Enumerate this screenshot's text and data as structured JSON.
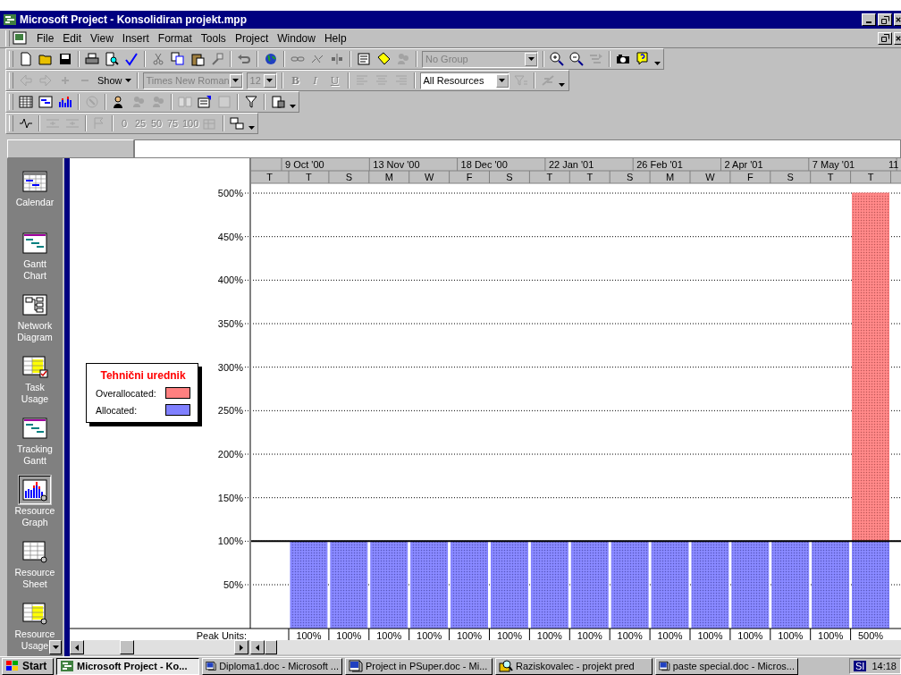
{
  "window": {
    "title": "Microsoft Project - Konsolidiran projekt.mpp"
  },
  "menu": [
    "File",
    "Edit",
    "View",
    "Insert",
    "Format",
    "Tools",
    "Project",
    "Window",
    "Help"
  ],
  "toolbars": [
    {
      "items": [
        {
          "kind": "button",
          "disabled": false
        },
        {
          "kind": "button",
          "disabled": false
        },
        {
          "kind": "button",
          "disabled": false
        },
        {
          "kind": "separator"
        },
        {
          "kind": "button",
          "disabled": false
        },
        {
          "kind": "button",
          "disabled": false
        },
        {
          "kind": "button",
          "disabled": false
        },
        {
          "kind": "separator"
        },
        {
          "kind": "button",
          "disabled": true
        },
        {
          "kind": "button",
          "disabled": false
        },
        {
          "kind": "button",
          "disabled": false
        },
        {
          "kind": "button",
          "disabled": true
        },
        {
          "kind": "separator"
        },
        {
          "kind": "button",
          "disabled": true
        },
        {
          "kind": "separator"
        },
        {
          "kind": "button",
          "disabled": false
        },
        {
          "kind": "separator"
        },
        {
          "kind": "button",
          "disabled": true
        },
        {
          "kind": "button",
          "disabled": true
        },
        {
          "kind": "button",
          "disabled": true
        },
        {
          "kind": "separator"
        },
        {
          "kind": "button",
          "disabled": false
        },
        {
          "kind": "button",
          "disabled": false
        },
        {
          "kind": "button",
          "disabled": true
        },
        {
          "kind": "separator"
        },
        {
          "kind": "combo",
          "value": "No Group",
          "disabled": true
        },
        {
          "kind": "separator"
        },
        {
          "kind": "button",
          "disabled": false
        },
        {
          "kind": "button",
          "disabled": false
        },
        {
          "kind": "button",
          "disabled": true
        },
        {
          "kind": "separator"
        },
        {
          "kind": "button",
          "disabled": false
        },
        {
          "kind": "button",
          "disabled": false
        },
        {
          "kind": "button",
          "disabled": false
        }
      ]
    },
    {
      "items": [
        {
          "kind": "button",
          "disabled": true
        },
        {
          "kind": "button",
          "disabled": true
        },
        {
          "kind": "button",
          "disabled": true
        },
        {
          "kind": "button",
          "disabled": true
        },
        {
          "kind": "menu",
          "label": "Show",
          "disabled": false
        },
        {
          "kind": "separator"
        },
        {
          "kind": "combo",
          "value": "Times New Roman",
          "disabled": true
        },
        {
          "kind": "combo",
          "value": "12",
          "disabled": true
        },
        {
          "kind": "separator"
        },
        {
          "kind": "text",
          "label": "B",
          "disabled": true
        },
        {
          "kind": "text",
          "label": "I",
          "disabled": true
        },
        {
          "kind": "text",
          "label": "U",
          "disabled": true
        },
        {
          "kind": "separator"
        },
        {
          "kind": "button",
          "disabled": true
        },
        {
          "kind": "button",
          "disabled": true
        },
        {
          "kind": "button",
          "disabled": true
        },
        {
          "kind": "separator"
        },
        {
          "kind": "combo",
          "value": "All Resources",
          "disabled": false
        },
        {
          "kind": "button",
          "disabled": true
        },
        {
          "kind": "separator"
        },
        {
          "kind": "button",
          "disabled": true
        },
        {
          "kind": "button",
          "disabled": false
        }
      ]
    },
    {
      "items": [
        {
          "kind": "button",
          "disabled": false
        },
        {
          "kind": "button",
          "disabled": false
        },
        {
          "kind": "button",
          "disabled": false
        },
        {
          "kind": "separator"
        },
        {
          "kind": "button",
          "disabled": true
        },
        {
          "kind": "separator"
        },
        {
          "kind": "button",
          "disabled": false
        },
        {
          "kind": "button",
          "disabled": true
        },
        {
          "kind": "button",
          "disabled": true
        },
        {
          "kind": "separator"
        },
        {
          "kind": "button",
          "disabled": true
        },
        {
          "kind": "button",
          "disabled": false
        },
        {
          "kind": "button",
          "disabled": true
        },
        {
          "kind": "separator"
        },
        {
          "kind": "button",
          "disabled": false
        },
        {
          "kind": "separator"
        },
        {
          "kind": "button",
          "disabled": false
        },
        {
          "kind": "button",
          "disabled": false
        }
      ]
    },
    {
      "items": [
        {
          "kind": "button",
          "disabled": false
        },
        {
          "kind": "separator"
        },
        {
          "kind": "button",
          "disabled": true
        },
        {
          "kind": "button",
          "disabled": true
        },
        {
          "kind": "separator"
        },
        {
          "kind": "button",
          "disabled": true
        },
        {
          "kind": "separator"
        },
        {
          "kind": "percent",
          "label": "0",
          "disabled": true
        },
        {
          "kind": "percent",
          "label": "25",
          "disabled": true
        },
        {
          "kind": "percent",
          "label": "50",
          "disabled": true
        },
        {
          "kind": "percent",
          "label": "75",
          "disabled": true
        },
        {
          "kind": "percent",
          "label": "100",
          "disabled": true
        },
        {
          "kind": "button",
          "disabled": true
        },
        {
          "kind": "separator"
        },
        {
          "kind": "button",
          "disabled": false
        },
        {
          "kind": "button",
          "disabled": false
        }
      ]
    }
  ],
  "view_bar": {
    "items": [
      {
        "label": "Calendar",
        "selected": false
      },
      {
        "label": "Gantt Chart",
        "selected": false
      },
      {
        "label": "Network Diagram",
        "selected": false
      },
      {
        "label": "Task Usage",
        "selected": false
      },
      {
        "label": "Tracking Gantt",
        "selected": false
      },
      {
        "label": "Resource Graph",
        "selected": true
      },
      {
        "label": "Resource Sheet",
        "selected": false
      },
      {
        "label": "Resource Usage",
        "selected": false
      }
    ]
  },
  "graph": {
    "legend": {
      "title": "Tehnični urednik",
      "items": [
        {
          "label": "Overallocated:",
          "color": "#ff8080"
        },
        {
          "label": "Allocated:",
          "color": "#8080ff"
        }
      ]
    },
    "timescale_major": [
      "9 Oct '00",
      "13 Nov '00",
      "18 Dec '00",
      "22 Jan '01",
      "26 Feb '01",
      "2 Apr '01",
      "7 May '01",
      "11"
    ],
    "peak_units_label": "Peak Units:",
    "peak_units": [
      "100%",
      "100%",
      "100%",
      "100%",
      "100%",
      "100%",
      "100%",
      "100%",
      "100%",
      "100%",
      "100%",
      "100%",
      "100%",
      "100%",
      "500%"
    ],
    "chart_data": {
      "type": "bar",
      "stacked": true,
      "grid": true,
      "categories": [
        "T",
        "T",
        "S",
        "M",
        "W",
        "F",
        "S",
        "T",
        "T",
        "S",
        "M",
        "W",
        "F",
        "S",
        "T",
        "T"
      ],
      "series": [
        {
          "color": "#8080ff",
          "values": [
            null,
            100,
            100,
            100,
            100,
            100,
            100,
            100,
            100,
            100,
            100,
            100,
            100,
            100,
            100,
            100
          ]
        },
        {
          "color": "#ff8080",
          "values": [
            null,
            0,
            0,
            0,
            0,
            0,
            0,
            0,
            0,
            0,
            0,
            0,
            0,
            0,
            0,
            400
          ]
        }
      ],
      "yticks": [
        {
          "value": 50,
          "label": "50%"
        },
        {
          "value": 100,
          "label": "100%"
        },
        {
          "value": 150,
          "label": "150%"
        },
        {
          "value": 200,
          "label": "200%"
        },
        {
          "value": 250,
          "label": "250%"
        },
        {
          "value": 300,
          "label": "300%"
        },
        {
          "value": 350,
          "label": "350%"
        },
        {
          "value": 400,
          "label": "400%"
        },
        {
          "value": 450,
          "label": "450%"
        },
        {
          "value": 500,
          "label": "500%"
        }
      ],
      "ylim": [
        0,
        511
      ],
      "ref_lines": [
        {
          "axis": "y",
          "value": 100
        }
      ]
    }
  },
  "taskbar": {
    "start": "Start",
    "tasks": [
      {
        "label": "Microsoft Project - Ko...",
        "selected": true
      },
      {
        "label": "Diploma1.doc - Microsoft ...",
        "selected": false
      },
      {
        "label": "Project in PSuper.doc - Mi...",
        "selected": false
      },
      {
        "label": "Raziskovalec - projekt pred",
        "selected": false
      },
      {
        "label": "paste special.doc - Micros...",
        "selected": false
      }
    ],
    "language": "SI",
    "clock": "14:18"
  }
}
